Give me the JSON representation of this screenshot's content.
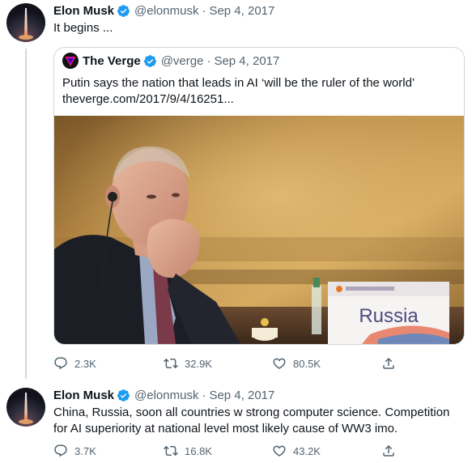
{
  "tweet1": {
    "name": "Elon Musk",
    "handle": "@elonmusk",
    "separator": "·",
    "date": "Sep 4, 2017",
    "text": "It begins ...",
    "avatar_icon": "rocket-launch-avatar",
    "quote": {
      "name": "The Verge",
      "handle": "@verge",
      "separator": "·",
      "date": "Sep 4, 2017",
      "text": "Putin says the nation that leads in AI ‘will be the ruler of the world’",
      "link": "theverge.com/2017/9/4/16251...",
      "image": {
        "placard_text": "Russia"
      }
    },
    "actions": {
      "replies": "2.3K",
      "retweets": "32.9K",
      "likes": "80.5K"
    }
  },
  "tweet2": {
    "name": "Elon Musk",
    "handle": "@elonmusk",
    "separator": "·",
    "date": "Sep 4, 2017",
    "text": "China, Russia, soon all countries w strong computer science. Competition for AI superiority at national level most likely cause of WW3 imo.",
    "avatar_icon": "rocket-launch-avatar",
    "actions": {
      "replies": "3.7K",
      "retweets": "16.8K",
      "likes": "43.2K"
    }
  },
  "colors": {
    "verified": "#1d9bf0",
    "muted": "#536471",
    "verge_logo": "#5200ff"
  }
}
